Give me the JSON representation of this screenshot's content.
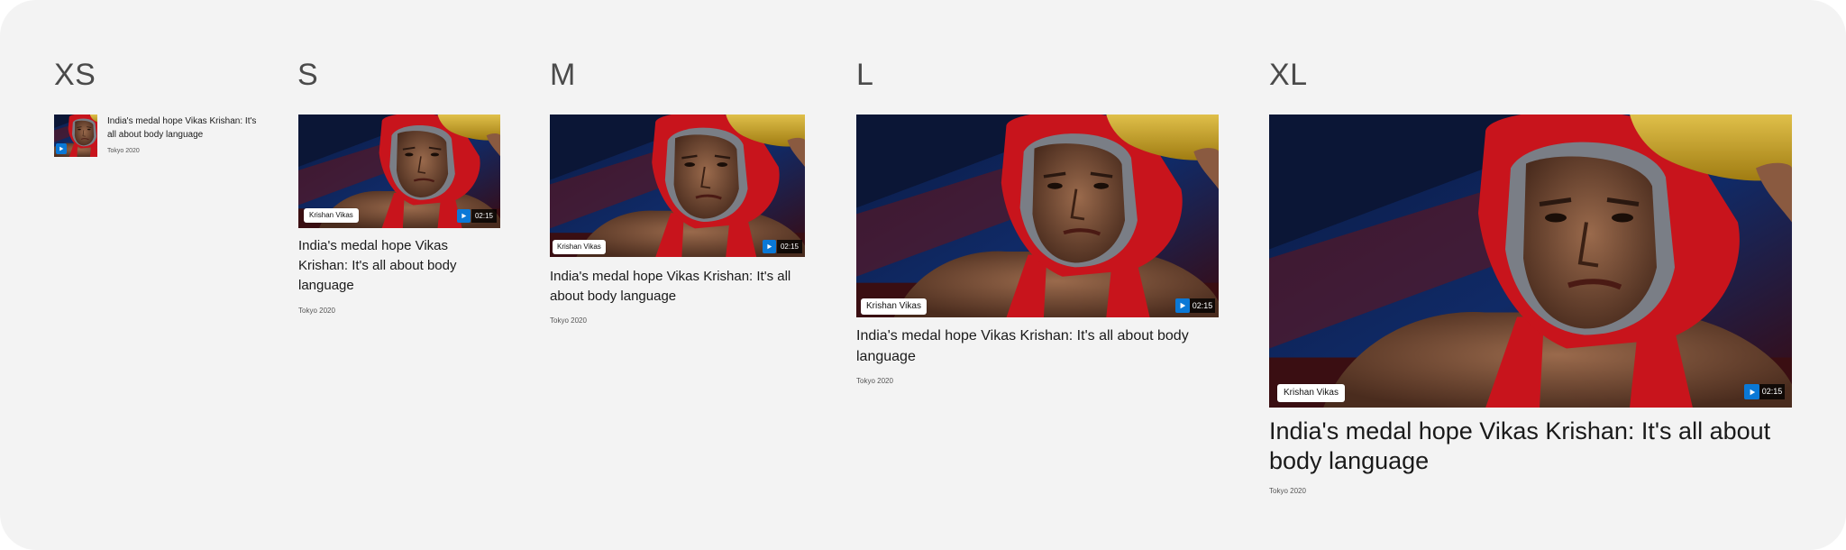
{
  "sizes": {
    "xs": {
      "label": "XS",
      "title": "India's medal hope Vikas Krishan: It's all about body language",
      "event": "Tokyo 2020"
    },
    "s": {
      "label": "S",
      "tag": "Krishan Vikas",
      "duration": "02:15",
      "title": "India's medal hope Vikas Krishan: It's all about body language",
      "event": "Tokyo 2020"
    },
    "m": {
      "label": "M",
      "tag": "Krishan Vikas",
      "duration": "02:15",
      "title": "India's medal hope Vikas Krishan: It's all about body language",
      "event": "Tokyo 2020"
    },
    "l": {
      "label": "L",
      "tag": "Krishan Vikas",
      "duration": "02:15",
      "title": "India's medal hope Vikas Krishan: It's all about body language",
      "event": "Tokyo 2020"
    },
    "xl": {
      "label": "XL",
      "tag": "Krishan Vikas",
      "duration": "02:15",
      "title": "India's medal hope Vikas Krishan: It's all about body language",
      "event": "Tokyo 2020"
    }
  },
  "icons": {
    "play": "play-icon"
  },
  "colors": {
    "background": "#f3f3f3",
    "play_button": "#0a78d6",
    "headgear": "#c8141c",
    "gold": "#c9a21f"
  }
}
